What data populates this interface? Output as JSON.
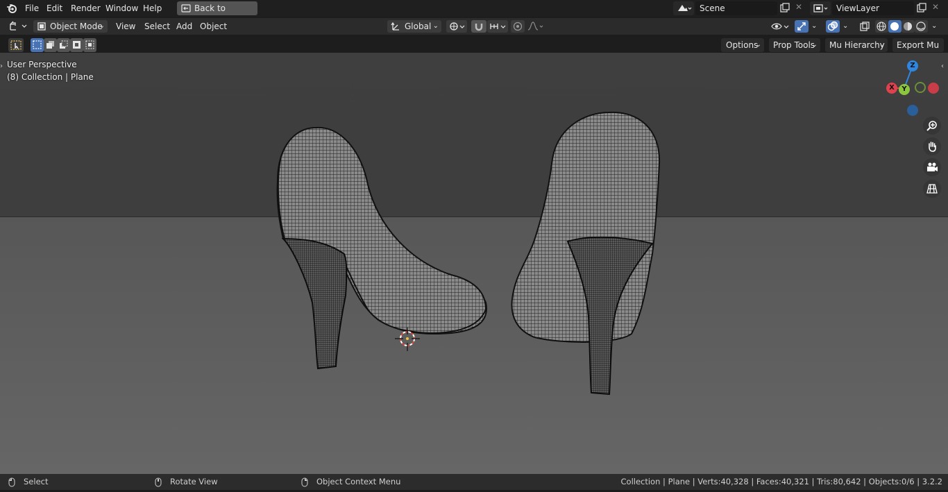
{
  "topbar": {
    "menus": [
      "File",
      "Edit",
      "Render",
      "Window",
      "Help"
    ],
    "back_button": "Back to Previous",
    "scene_field": "Scene",
    "viewlayer_field": "ViewLayer"
  },
  "header": {
    "mode": "Object Mode",
    "menus": [
      "View",
      "Select",
      "Add",
      "Object"
    ],
    "transform_orientation": "Global"
  },
  "toolrow": {
    "options": "Options",
    "prop_tools": "Prop Tools",
    "mu_hierarchy": "Mu Hierarchy",
    "export_mu": "Export Mu"
  },
  "viewport": {
    "perspective_label": "User Perspective",
    "collection_label": "(8) Collection | Plane",
    "gizmo": {
      "z": "Z",
      "x": "X",
      "y": "Y"
    }
  },
  "statusbar": {
    "select": "Select",
    "rotate": "Rotate View",
    "context_menu": "Object Context Menu",
    "stats": "Collection | Plane | Verts:40,328 | Faces:40,321 | Tris:80,642 | Objects:0/6 | 3.2.2"
  },
  "colors": {
    "axis_x": "#e0414f",
    "axis_y": "#8cc63f",
    "axis_z": "#2f86e0",
    "accent_blue": "#4772b3"
  }
}
